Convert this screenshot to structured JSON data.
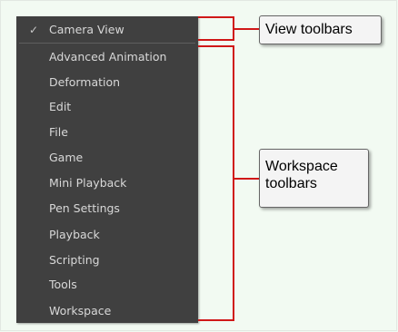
{
  "menu": {
    "items": [
      {
        "label": "Camera View",
        "checked": true
      },
      {
        "label": "Advanced Animation",
        "checked": false
      },
      {
        "label": "Deformation",
        "checked": false
      },
      {
        "label": "Edit",
        "checked": false
      },
      {
        "label": "File",
        "checked": false
      },
      {
        "label": "Game",
        "checked": false
      },
      {
        "label": "Mini Playback",
        "checked": false
      },
      {
        "label": "Pen Settings",
        "checked": false
      },
      {
        "label": "Playback",
        "checked": false
      },
      {
        "label": "Scripting",
        "checked": false
      },
      {
        "label": "Tools",
        "checked": false
      },
      {
        "label": "Workspace",
        "checked": false
      }
    ],
    "check_glyph": "✓"
  },
  "callouts": {
    "view_toolbars": {
      "line1": "View toolbars"
    },
    "workspace_toolbars": {
      "line1": "Workspace",
      "line2": "toolbars"
    }
  },
  "colors": {
    "menu_bg": "#404040",
    "menu_text": "#d8d8d8",
    "bracket_red": "#d01818",
    "page_bg": "#f2faf2"
  }
}
